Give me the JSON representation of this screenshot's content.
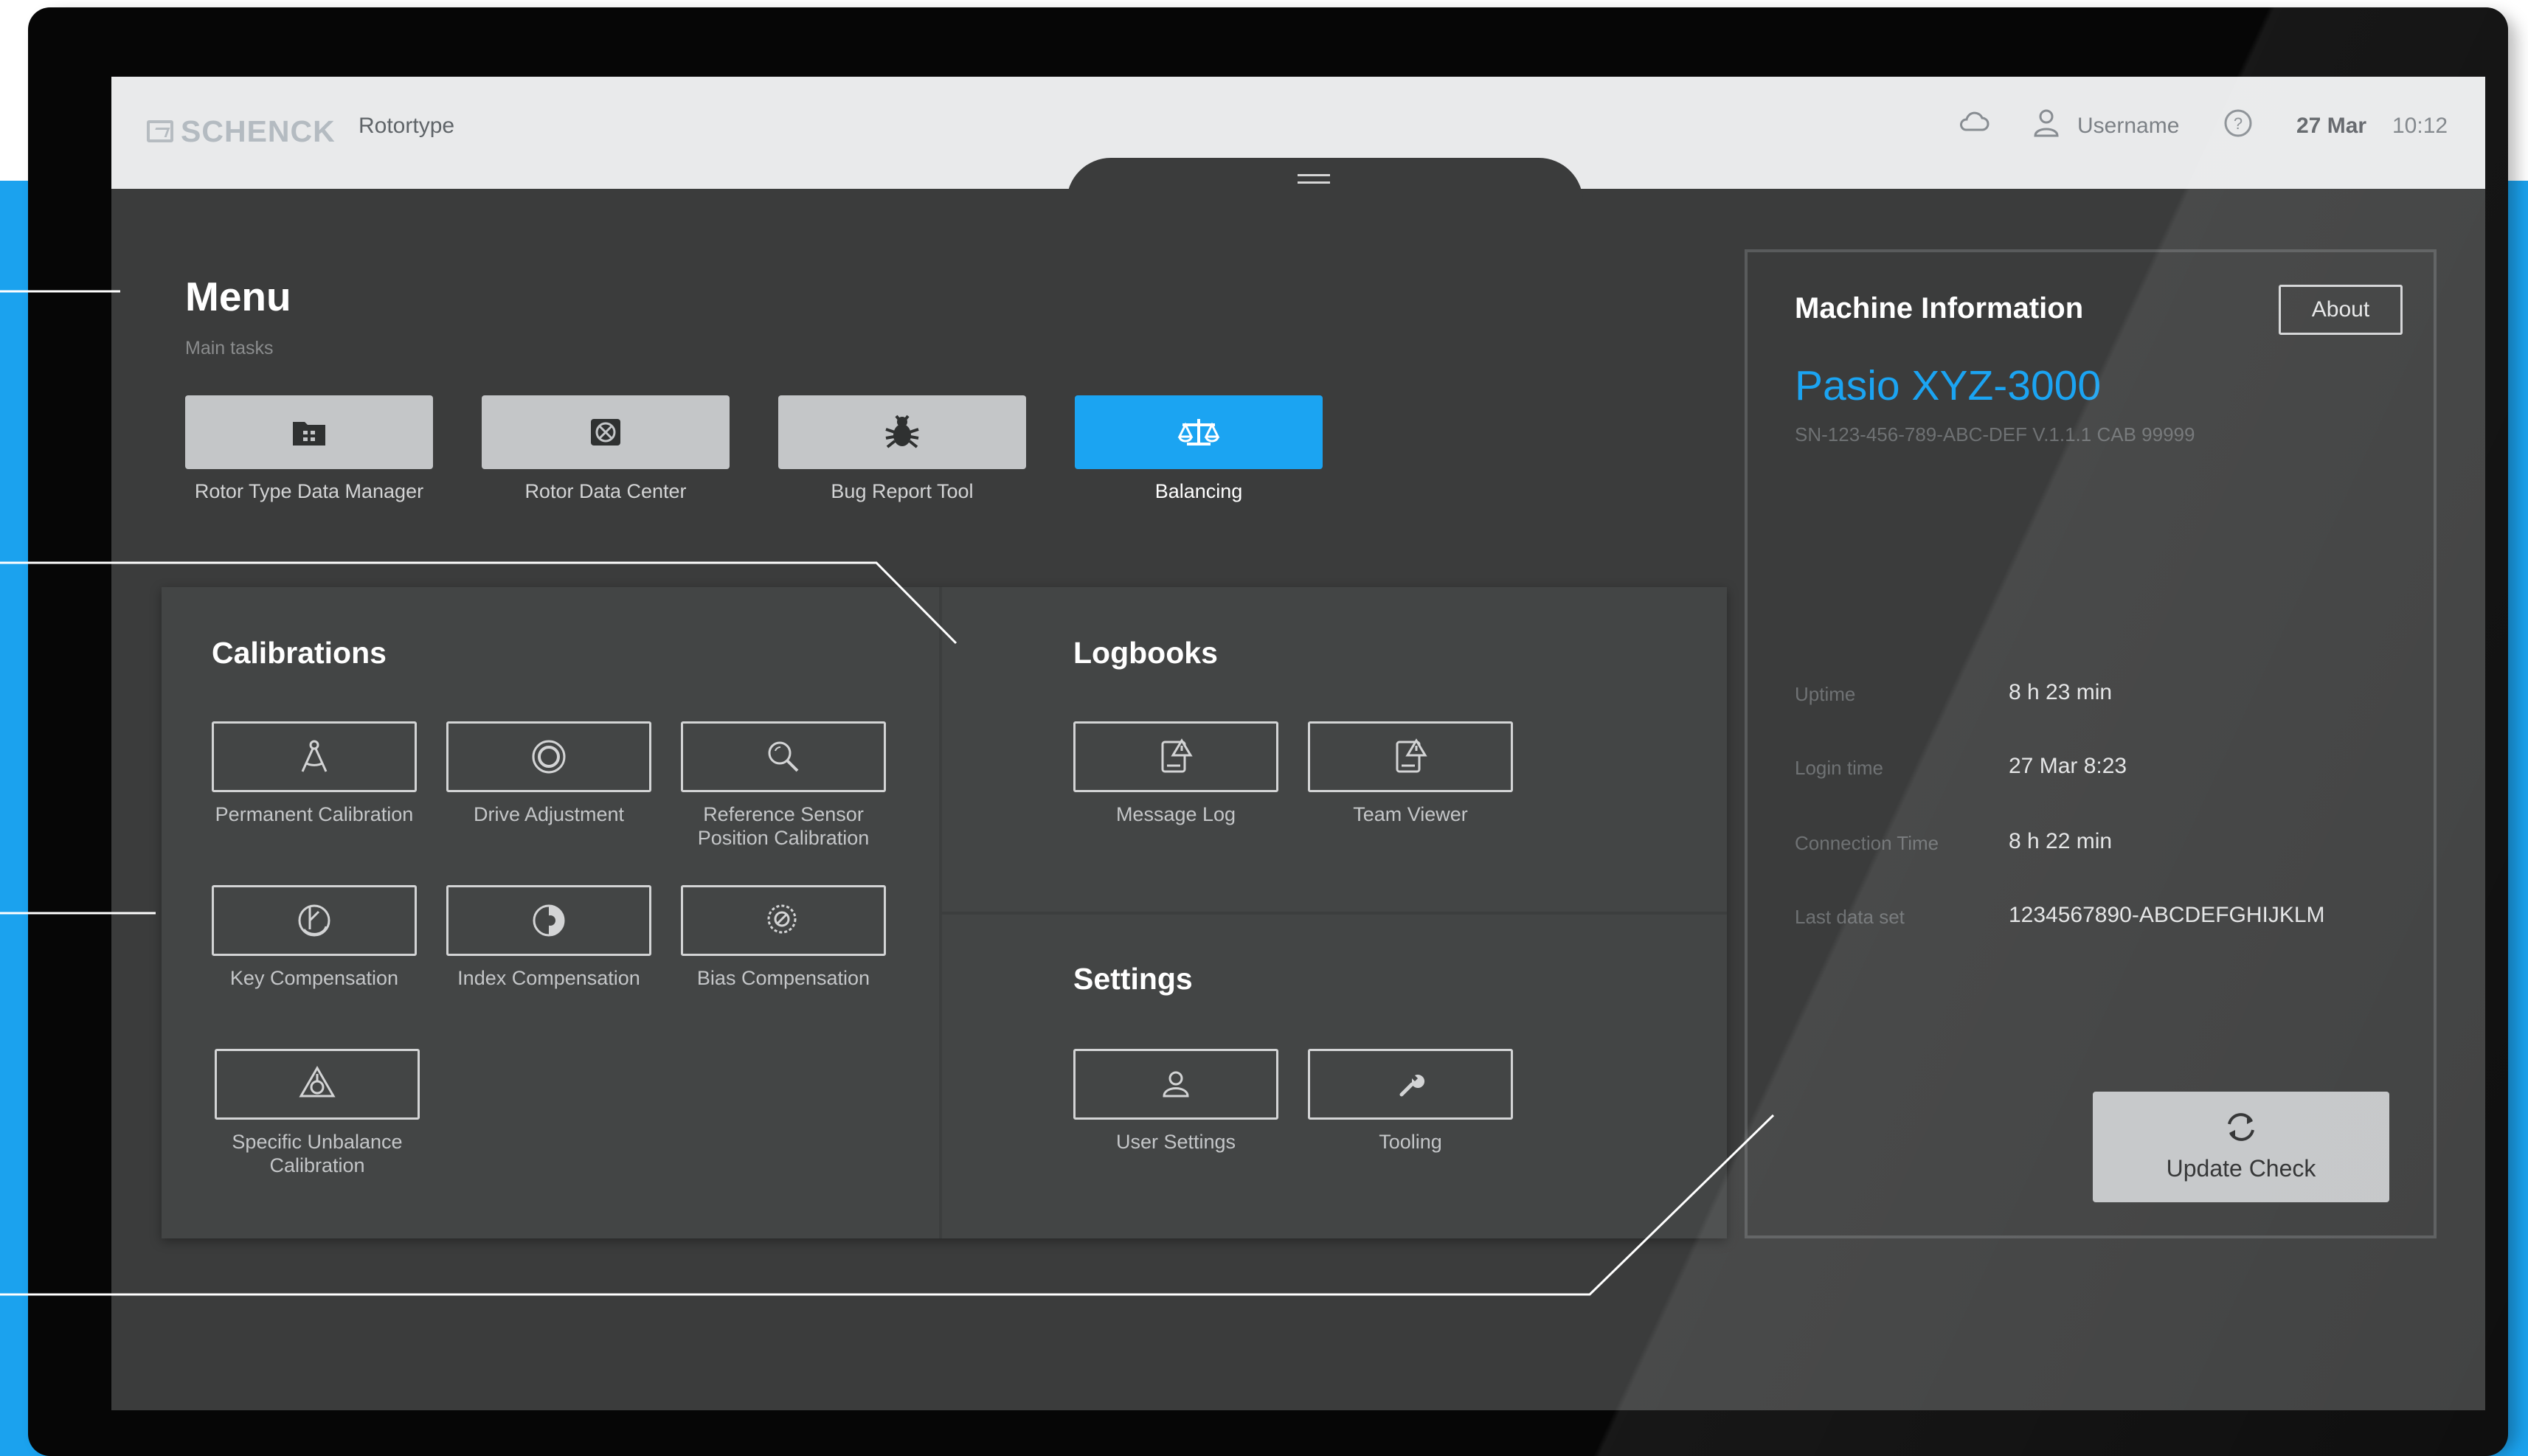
{
  "header": {
    "logo": "SCHENCK",
    "app_name": "Rotortype",
    "username": "Username",
    "date": "27 Mar",
    "time": "10:12",
    "icons": [
      "cloud-icon",
      "user-icon",
      "help-icon"
    ]
  },
  "menu": {
    "title": "Menu",
    "subtitle": "Main tasks",
    "tasks": [
      {
        "label": "Rotor Type Data Manager",
        "icon": "folder-icon",
        "active": false
      },
      {
        "label": "Rotor Data Center",
        "icon": "rotor-icon",
        "active": false
      },
      {
        "label": "Bug Report Tool",
        "icon": "bug-icon",
        "active": false
      },
      {
        "label": "Balancing",
        "icon": "scale-icon",
        "active": true
      }
    ]
  },
  "calibrations": {
    "title": "Calibrations",
    "items": [
      {
        "label": "Permanent Calibration",
        "icon": "compass-icon"
      },
      {
        "label": "Drive Adjustment",
        "icon": "target-icon"
      },
      {
        "label": "Reference Sensor Position Calibration",
        "icon": "sensor-search-icon"
      },
      {
        "label": "Key Compensation",
        "icon": "key-compensation-icon"
      },
      {
        "label": "Index Compensation",
        "icon": "index-compensation-icon"
      },
      {
        "label": "Bias Compensation",
        "icon": "bias-compensation-icon"
      },
      {
        "label": "Specific Unbalance Calibration",
        "icon": "unbalance-icon"
      }
    ]
  },
  "logbooks": {
    "title": "Logbooks",
    "items": [
      {
        "label": "Message Log",
        "icon": "log-warning-icon"
      },
      {
        "label": "Team Viewer",
        "icon": "log-warning-icon"
      }
    ]
  },
  "settings": {
    "title": "Settings",
    "items": [
      {
        "label": "User Settings",
        "icon": "user-settings-icon"
      },
      {
        "label": "Tooling",
        "icon": "wrench-icon"
      }
    ]
  },
  "machine_info": {
    "title": "Machine Information",
    "about_label": "About",
    "model": "Pasio XYZ-3000",
    "serial": "SN-123-456-789-ABC-DEF V.1.1.1 CAB 99999",
    "fields": [
      {
        "key": "Uptime",
        "value": "8 h 23 min"
      },
      {
        "key": "Login time",
        "value": "27 Mar 8:23"
      },
      {
        "key": "Connection Time",
        "value": "8 h 22 min"
      },
      {
        "key": "Last data set",
        "value": "1234567890-ABCDEFGHIJKLM"
      }
    ],
    "update_label": "Update Check"
  },
  "colors": {
    "accent": "#1ba4f2",
    "screen_bg": "#3b3c3c",
    "panel_bg": "#434545",
    "header_bg": "#e9eaeb",
    "backdrop": "#1ba2ee"
  }
}
